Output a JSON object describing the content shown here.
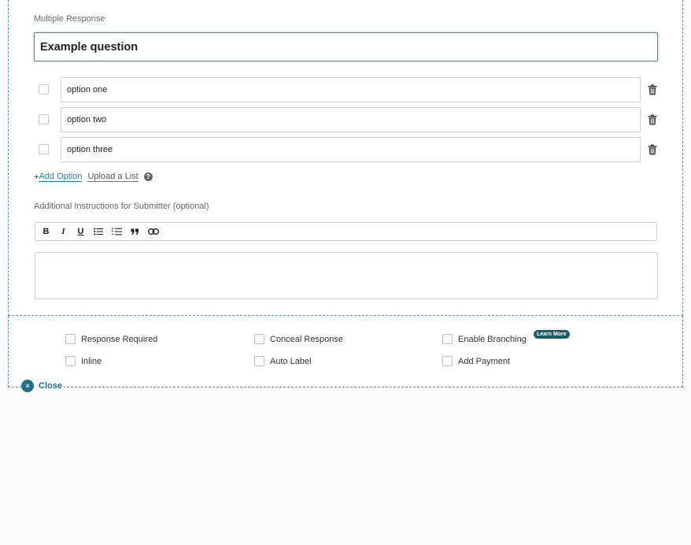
{
  "question": {
    "type_label": "Multiple Response",
    "text": "Example question"
  },
  "options": [
    {
      "label": "option one"
    },
    {
      "label": "option two"
    },
    {
      "label": "option three"
    }
  ],
  "option_actions": {
    "add_prefix": "+",
    "add_label": "Add Option",
    "upload_label": "Upload a List",
    "help_icon": "?"
  },
  "instructions": {
    "label": "Additional Instructions for Submitter (optional)",
    "toolbar": {
      "bold": "B",
      "italic": "I",
      "underline": "U"
    },
    "value": ""
  },
  "settings": {
    "response_required": "Response Required",
    "conceal_response": "Conceal Response",
    "enable_branching": "Enable Branching",
    "learn_more": "Learn More",
    "inline": "Inline",
    "auto_label": "Auto Label",
    "add_payment": "Add Payment"
  },
  "close": {
    "icon": "×",
    "label": "Close"
  },
  "colors": {
    "accent": "#1f7ea3",
    "badge": "#1d5a63",
    "close": "#1f6e8c"
  }
}
